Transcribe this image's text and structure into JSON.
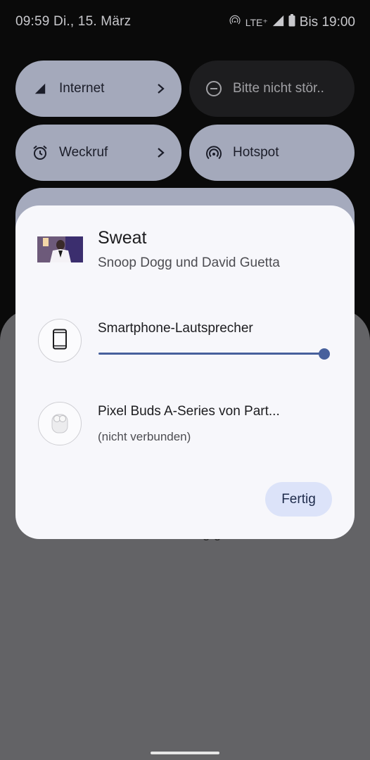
{
  "status_bar": {
    "time_date": "09:59 Di., 15. März",
    "network": "LTE⁺",
    "battery_text": "Bis 19:00"
  },
  "quick_settings": {
    "tiles": [
      {
        "label": "Internet",
        "icon": "signal-icon",
        "active": true
      },
      {
        "label": "Bitte nicht stör..",
        "icon": "do-not-disturb-icon",
        "active": false
      },
      {
        "label": "Weckruf",
        "icon": "alarm-icon",
        "active": true
      },
      {
        "label": "Hotspot",
        "icon": "hotspot-icon",
        "active": true
      }
    ]
  },
  "background": {
    "partial_text": "g g"
  },
  "output_dialog": {
    "song_title": "Sweat",
    "song_artist": "Snoop Dogg und David Guetta",
    "devices": [
      {
        "name": "Smartphone-Lautsprecher",
        "icon": "smartphone-icon",
        "volume": 1.0
      },
      {
        "name": "Pixel Buds A-Series von Part...",
        "status": "(nicht verbunden)",
        "icon": "earbuds-icon"
      }
    ],
    "done_label": "Fertig"
  },
  "colors": {
    "accent": "#47609c",
    "tile_active": "#a4a9bb",
    "tile_inactive": "#1d1d1f",
    "dialog_bg": "#f7f7fb",
    "done_button_bg": "#dce3f9"
  }
}
